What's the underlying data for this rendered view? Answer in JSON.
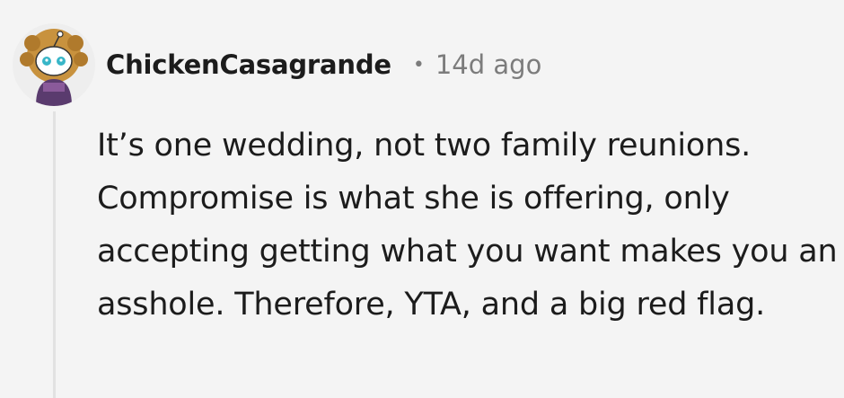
{
  "comment": {
    "username": "ChickenCasagrande",
    "separator": "•",
    "timestamp": "14d ago",
    "body": "It’s one wedding, not two family reunions. Compromise is what she is offering, only accepting getting what you want makes you an asshole. Therefore, YTA, and a big red flag.",
    "avatar_icon": "snoo-avatar-icon"
  }
}
